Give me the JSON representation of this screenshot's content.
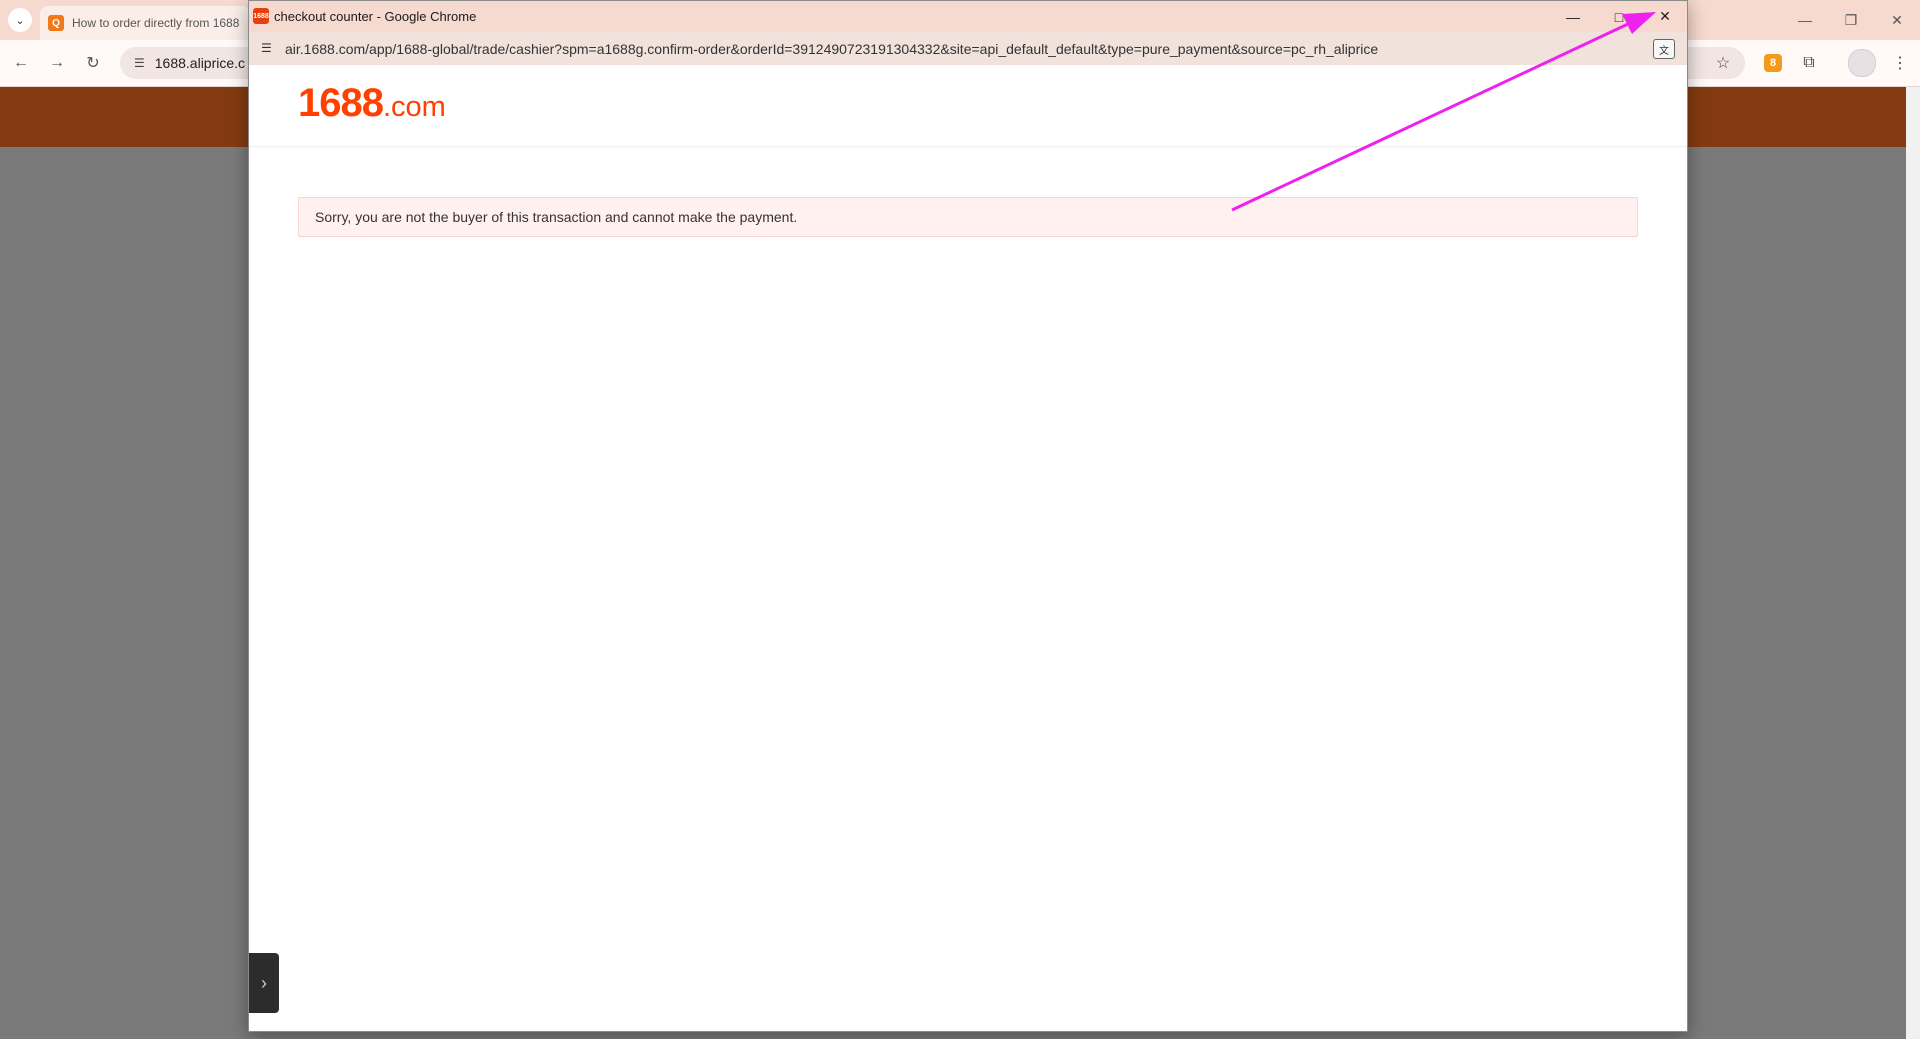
{
  "main_browser": {
    "tab_title": "How to order directly from 1688",
    "omnibox_url": "1688.aliprice.c",
    "minimize_glyph": "—",
    "restore_glyph": "❐",
    "close_glyph": "✕",
    "extension_badge": "8"
  },
  "popup": {
    "window_title": "checkout counter - Google Chrome",
    "favicon_text": "1688",
    "url": "air.1688.com/app/1688-global/trade/cashier?spm=a1688g.confirm-order&orderId=3912490723191304332&site=api_default_default&type=pure_payment&source=pc_rh_aliprice",
    "minimize_glyph": "—",
    "maximize_glyph": "□",
    "close_glyph": "✕"
  },
  "page": {
    "logo_number": "1688",
    "logo_suffix": ".com",
    "alert_message": "Sorry, you are not the buyer of this transaction and cannot make the payment."
  },
  "colors": {
    "brand_orange": "#ff4000",
    "site_header": "#843a10",
    "annotation_arrow": "#ee22ee"
  }
}
